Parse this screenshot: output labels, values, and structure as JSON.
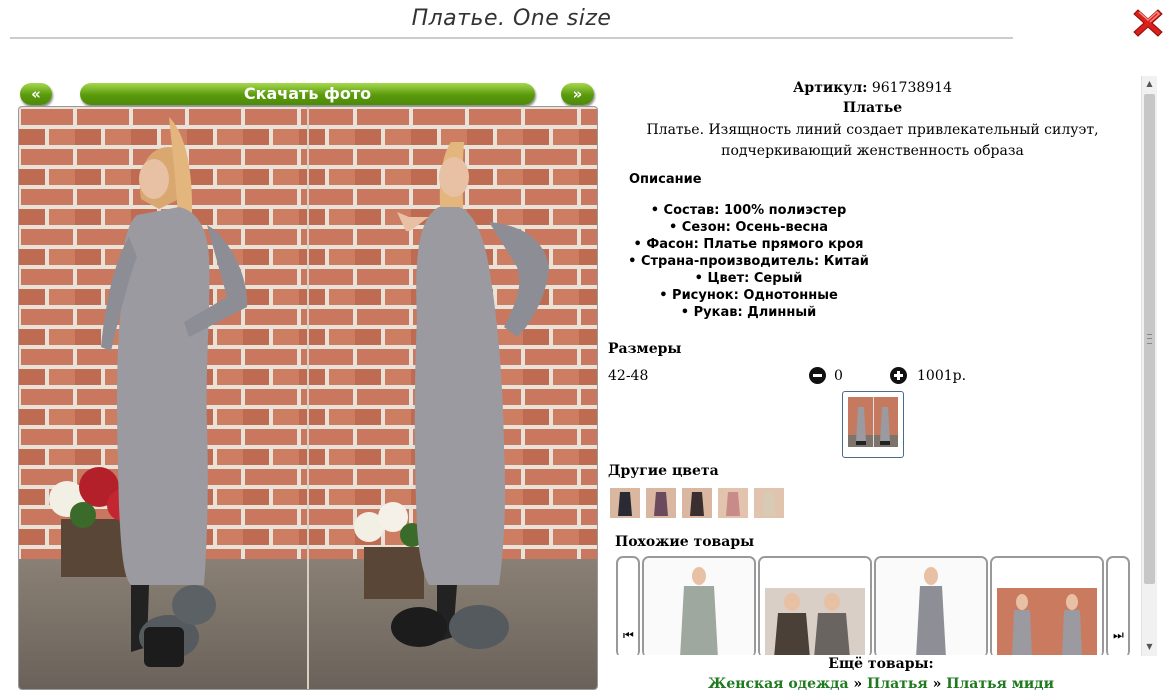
{
  "title": "Платье. One size",
  "gallery": {
    "prev_label": "«",
    "next_label": "»",
    "download_label": "Скачать фото"
  },
  "product": {
    "article_label": "Артикул:",
    "article_value": "961738914",
    "name": "Платье",
    "description": "Платье. Изящность линий создает привлекательный силуэт, подчеркивающий женственность образа",
    "specs_heading": "Описание",
    "specs": [
      "Состав: 100% полиэстер",
      "Сезон: Осень-весна",
      "Фасон: Платье прямого кроя",
      "Страна-производитель: Китай",
      "Цвет: Серый",
      "Рисунок: Однотонные",
      "Рукав: Длинный"
    ]
  },
  "sizes": {
    "heading": "Размеры",
    "size": "42-48",
    "quantity": "0",
    "price": "1001р."
  },
  "colors": {
    "heading": "Другие цвета",
    "swatches": [
      "#2a2a35",
      "#6b4a5e",
      "#3a2e30",
      "#c98a8a",
      "#d8cbb5"
    ]
  },
  "similar": {
    "heading": "Похожие товары"
  },
  "footer": {
    "more_label": "Ещё товары:",
    "crumb1": "Женская одежда",
    "crumb2": "Платья",
    "crumb3": "Платья миди",
    "separator": "»"
  },
  "accent_colors": {
    "button_green": "#5a9a0c",
    "link_green": "#1e7a1e",
    "close_red": "#d9201a"
  }
}
